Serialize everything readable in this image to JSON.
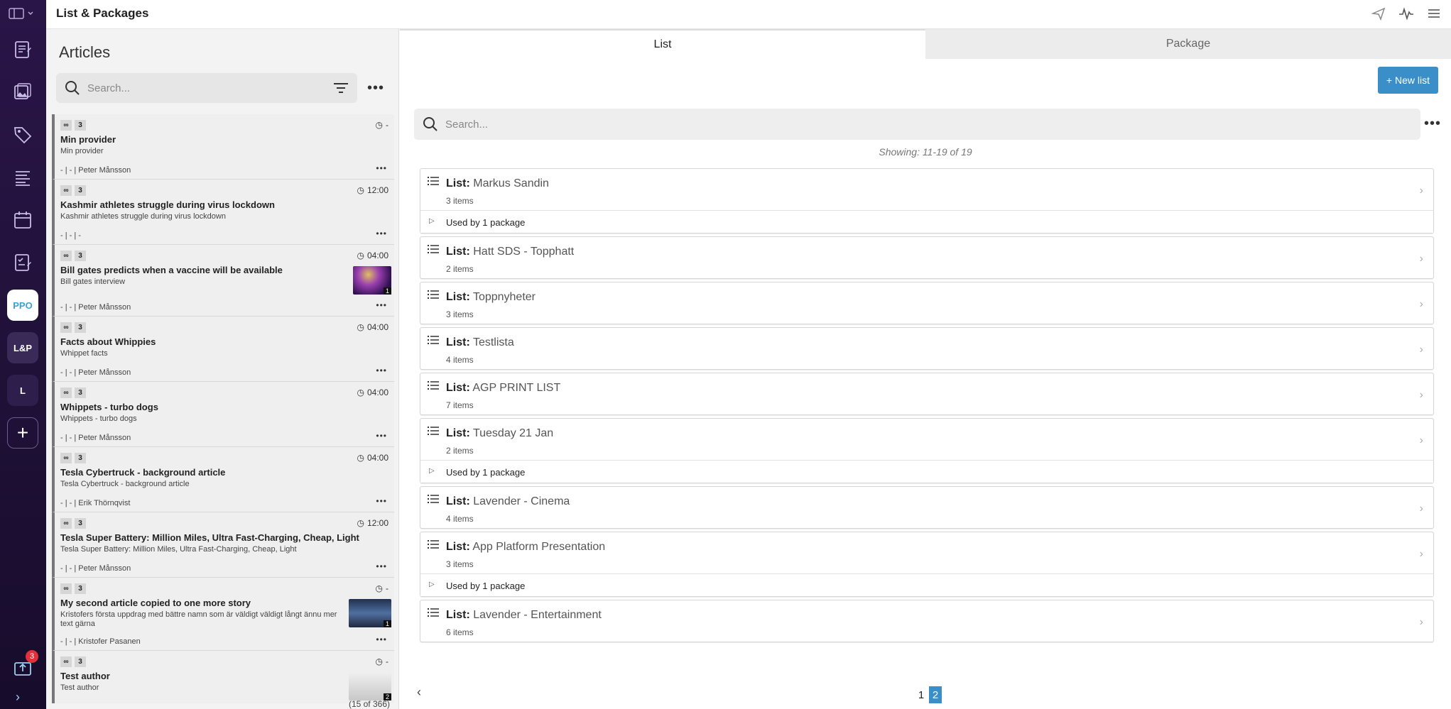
{
  "app": {
    "title": "List & Packages"
  },
  "rail": {
    "pills": {
      "ppo": "PPO",
      "lp": "L&P",
      "l": "L"
    },
    "add_label": "+",
    "notification_count": "3",
    "expand_label": "›"
  },
  "articles": {
    "heading": "Articles",
    "search_placeholder": "Search...",
    "count_text": "(15 of 366)",
    "items": [
      {
        "tag1": "∞",
        "tag2": "3",
        "time": "-",
        "headline": "Min provider",
        "sub": "Min provider",
        "meta": "- | - | Peter Månsson"
      },
      {
        "tag1": "∞",
        "tag2": "3",
        "time": "12:00",
        "headline": "Kashmir athletes struggle during virus lockdown",
        "sub": "Kashmir athletes struggle during virus lockdown",
        "meta": "- | - | -"
      },
      {
        "tag1": "∞",
        "tag2": "3",
        "time": "04:00",
        "headline": "Bill gates predicts when a vaccine will be available",
        "sub": "Bill gates interview",
        "meta": "- | - | Peter Månsson",
        "thumb_count": "1"
      },
      {
        "tag1": "∞",
        "tag2": "3",
        "time": "04:00",
        "headline": "Facts about Whippies",
        "sub": "Whippet facts",
        "meta": "- | - | Peter Månsson"
      },
      {
        "tag1": "∞",
        "tag2": "3",
        "time": "04:00",
        "headline": "Whippets - turbo dogs",
        "sub": "Whippets - turbo dogs",
        "meta": "- | - | Peter Månsson"
      },
      {
        "tag1": "∞",
        "tag2": "3",
        "time": "04:00",
        "headline": "Tesla Cybertruck - background article",
        "sub": "Tesla Cybertruck - background article",
        "meta": "- | - | Erik Thörnqvist"
      },
      {
        "tag1": "∞",
        "tag2": "3",
        "time": "12:00",
        "headline": "Tesla Super Battery: Million Miles, Ultra Fast-Charging, Cheap, Light",
        "sub": "Tesla Super Battery: Million Miles, Ultra Fast-Charging, Cheap, Light",
        "meta": "- | - | Peter Månsson"
      },
      {
        "tag1": "∞",
        "tag2": "3",
        "time": "-",
        "headline": "My second article copied to one more story",
        "sub": "Kristofers första uppdrag med bättre namn som är väldigt väldigt långt ännu mer text gärna",
        "meta": "- | - | Kristofer Pasanen",
        "thumb_count": "1"
      },
      {
        "tag1": "∞",
        "tag2": "3",
        "time": "-",
        "headline": "Test author",
        "sub": "Test author",
        "meta": "",
        "thumb_count": "2"
      }
    ]
  },
  "main": {
    "tabs": [
      {
        "label": "List"
      },
      {
        "label": "Package"
      }
    ],
    "new_list_label": "+ New list",
    "search_placeholder": "Search...",
    "showing": "Showing: 11-19 of 19",
    "list_prefix": "List:",
    "lists": [
      {
        "name": "Markus Sandin",
        "count": "3 items",
        "used": "Used by 1 package"
      },
      {
        "name": "Hatt SDS - Topphatt",
        "count": "2 items"
      },
      {
        "name": "Toppnyheter",
        "count": "3 items"
      },
      {
        "name": "Testlista",
        "count": "4 items"
      },
      {
        "name": "AGP PRINT LIST",
        "count": "7 items"
      },
      {
        "name": "Tuesday 21 Jan",
        "count": "2 items",
        "used": "Used by 1 package"
      },
      {
        "name": "Lavender - Cinema",
        "count": "4 items"
      },
      {
        "name": "App Platform Presentation",
        "count": "3 items",
        "used": "Used by 1 package"
      },
      {
        "name": "Lavender - Entertainment",
        "count": "6 items"
      }
    ],
    "pager": {
      "prev": "‹",
      "pages": [
        "1",
        "2"
      ],
      "current": "2"
    }
  }
}
